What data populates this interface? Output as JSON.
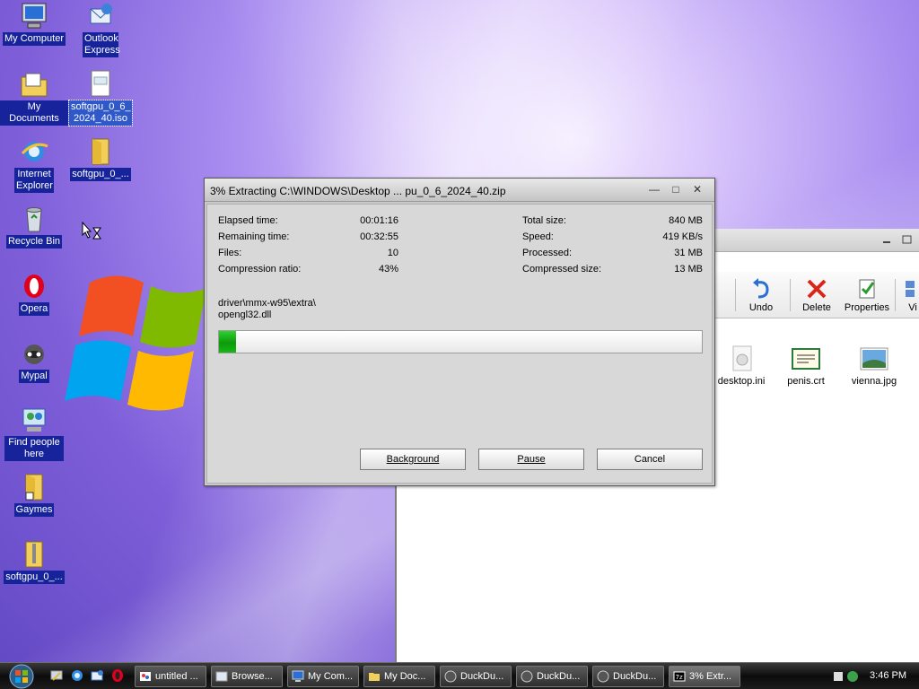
{
  "desktop": {
    "icons": [
      {
        "label": "My Computer",
        "icon": "my-computer-icon"
      },
      {
        "label": "Outlook Express",
        "icon": "outlook-express-icon"
      },
      {
        "label": "My Documents",
        "icon": "my-documents-icon"
      },
      {
        "label": "softgpu_0_6_2024_40.iso",
        "label_display": "softgpu_0_6_\n2024_40.iso",
        "icon": "iso-file-icon"
      },
      {
        "label": "Internet Explorer",
        "icon": "internet-explorer-icon"
      },
      {
        "label": "softgpu_0_...",
        "icon": "folder-icon"
      },
      {
        "label": "Recycle Bin",
        "icon": "recycle-bin-icon"
      },
      {
        "label": "Opera",
        "icon": "opera-icon"
      },
      {
        "label": "Mypal",
        "icon": "mypal-icon"
      },
      {
        "label": "Find people here",
        "icon": "find-people-icon"
      },
      {
        "label": "Gaymes",
        "icon": "folder-shortcut-icon"
      },
      {
        "label": "softgpu_0_...",
        "icon": "zip-folder-icon"
      }
    ]
  },
  "explorer": {
    "toolbar": [
      {
        "label": "Undo",
        "icon": "undo-icon"
      },
      {
        "label": "Delete",
        "icon": "delete-icon"
      },
      {
        "label": "Properties",
        "icon": "properties-icon"
      },
      {
        "label": "Vi",
        "icon": "views-icon"
      }
    ],
    "files": [
      {
        "name": "desktop.ini",
        "icon": "ini-file-icon"
      },
      {
        "name": "penis.crt",
        "icon": "certificate-icon"
      },
      {
        "name": "vienna.jpg",
        "icon": "image-file-icon"
      }
    ]
  },
  "dialog": {
    "title": "3% Extracting C:\\WINDOWS\\Desktop ... pu_0_6_2024_40.zip",
    "left_stats": [
      {
        "label": "Elapsed time:",
        "value": "00:01:16"
      },
      {
        "label": "Remaining time:",
        "value": "00:32:55"
      },
      {
        "label": "Files:",
        "value": "10"
      },
      {
        "label": "Compression ratio:",
        "value": "43%"
      }
    ],
    "right_stats": [
      {
        "label": "Total size:",
        "value": "840 MB"
      },
      {
        "label": "Speed:",
        "value": "419 KB/s"
      },
      {
        "label": "Processed:",
        "value": "31 MB"
      },
      {
        "label": "Compressed size:",
        "value": "13 MB"
      }
    ],
    "current_path": "driver\\mmx-w95\\extra\\",
    "current_file": "opengl32.dll",
    "progress_percent": 3,
    "buttons": {
      "background": "Background",
      "pause": "Pause",
      "cancel": "Cancel"
    }
  },
  "taskbar": {
    "quick_launch": [
      "show-desktop-icon",
      "internet-explorer-icon",
      "outlook-express-icon",
      "opera-icon"
    ],
    "tasks": [
      {
        "label": "untitled ...",
        "icon": "paint-icon"
      },
      {
        "label": "Browse...",
        "icon": "browser-icon"
      },
      {
        "label": "My Com...",
        "icon": "my-computer-icon"
      },
      {
        "label": "My Doc...",
        "icon": "folder-icon"
      },
      {
        "label": "DuckDu...",
        "icon": "duckduckgo-icon"
      },
      {
        "label": "DuckDu...",
        "icon": "duckduckgo-icon"
      },
      {
        "label": "DuckDu...",
        "icon": "duckduckgo-icon"
      },
      {
        "label": "3% Extr...",
        "icon": "7zip-icon"
      }
    ],
    "clock": "3:46 PM"
  }
}
